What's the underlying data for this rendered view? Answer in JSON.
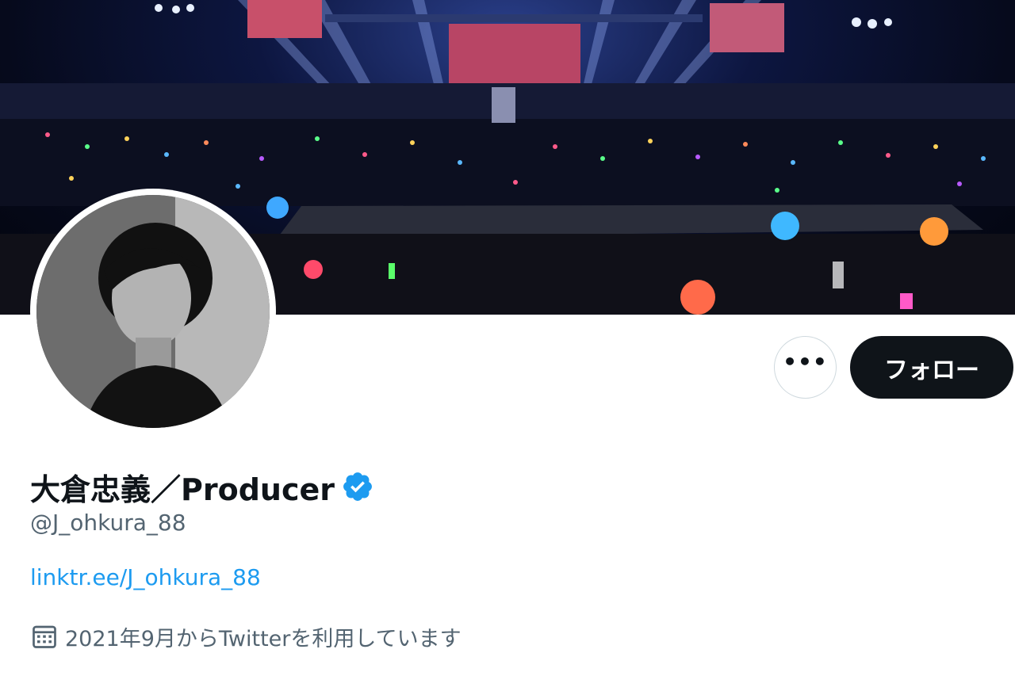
{
  "profile": {
    "display_name": "大倉忠義／Producer",
    "handle": "@J_ohkura_88",
    "link_text": "linktr.ee/J_ohkura_88",
    "joined_text": "2021年9月からTwitterを利用しています",
    "verified": true
  },
  "actions": {
    "more_label": "•••",
    "follow_label": "フォロー"
  },
  "icons": {
    "verified": "verified-badge-icon",
    "calendar": "calendar-icon",
    "more": "more-options-icon"
  },
  "colors": {
    "link": "#1d9bf0",
    "secondary_text": "#536471",
    "follow_bg": "#0f1419",
    "verified": "#1d9bf0"
  }
}
